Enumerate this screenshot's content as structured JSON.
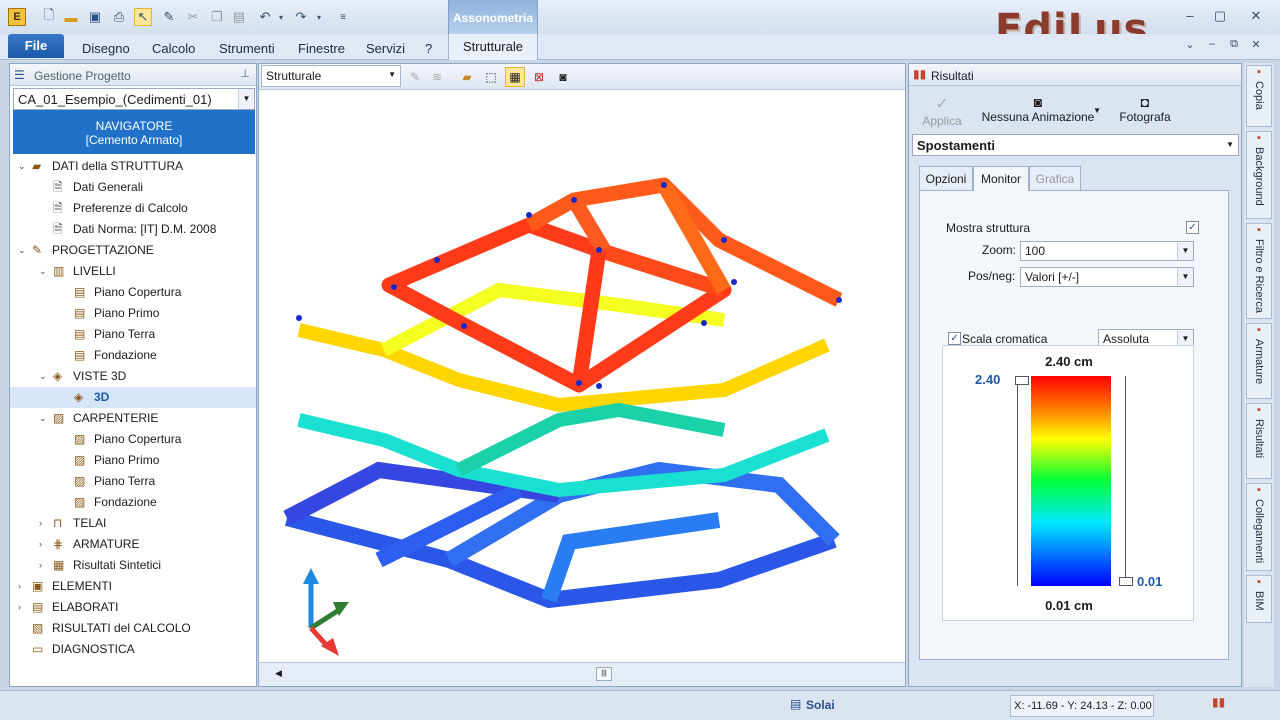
{
  "titlebar": {
    "context_tab": "Assonometria",
    "brand": "EdiLus",
    "win_controls": [
      "–",
      "▢",
      "✕"
    ],
    "doc_controls": [
      "⌄",
      "–",
      "⧉",
      "✕"
    ]
  },
  "menu": {
    "file": "File",
    "items": [
      "Disegno",
      "Calcolo",
      "Strumenti",
      "Finestre",
      "Servizi",
      "?"
    ],
    "context_sub": "Strutturale"
  },
  "left_panel": {
    "title": "Gestione Progetto",
    "project": "CA_01_Esempio_(Cedimenti_01)",
    "navigator_line1": "NAVIGATORE",
    "navigator_line2": "[Cemento Armato]",
    "tree": [
      {
        "label": "DATI della STRUTTURA",
        "level": 0,
        "expander": "⌄",
        "icon": "folder-icon"
      },
      {
        "label": "Dati Generali",
        "level": 1,
        "expander": "",
        "icon": "document-icon"
      },
      {
        "label": "Preferenze di Calcolo",
        "level": 1,
        "expander": "",
        "icon": "document-icon"
      },
      {
        "label": "Dati Norma: [IT] D.M. 2008",
        "level": 1,
        "expander": "",
        "icon": "document-icon"
      },
      {
        "label": "PROGETTAZIONE",
        "level": 0,
        "expander": "⌄",
        "icon": "design-icon"
      },
      {
        "label": "LIVELLI",
        "level": 1,
        "expander": "⌄",
        "icon": "levels-icon"
      },
      {
        "label": "Piano Copertura",
        "level": 2,
        "expander": "",
        "icon": "floor-icon"
      },
      {
        "label": "Piano Primo",
        "level": 2,
        "expander": "",
        "icon": "floor-icon"
      },
      {
        "label": "Piano Terra",
        "level": 2,
        "expander": "",
        "icon": "floor-icon"
      },
      {
        "label": "Fondazione",
        "level": 2,
        "expander": "",
        "icon": "floor-icon"
      },
      {
        "label": "VISTE 3D",
        "level": 1,
        "expander": "⌄",
        "icon": "view3d-icon"
      },
      {
        "label": "3D",
        "level": 2,
        "expander": "",
        "icon": "view3d-icon",
        "selected": true
      },
      {
        "label": "CARPENTERIE",
        "level": 1,
        "expander": "⌄",
        "icon": "formwork-icon"
      },
      {
        "label": "Piano Copertura",
        "level": 2,
        "expander": "",
        "icon": "formwork-icon"
      },
      {
        "label": "Piano Primo",
        "level": 2,
        "expander": "",
        "icon": "formwork-icon"
      },
      {
        "label": "Piano Terra",
        "level": 2,
        "expander": "",
        "icon": "formwork-icon"
      },
      {
        "label": "Fondazione",
        "level": 2,
        "expander": "",
        "icon": "formwork-icon"
      },
      {
        "label": "TELAI",
        "level": 1,
        "expander": "›",
        "icon": "frame-icon"
      },
      {
        "label": "ARMATURE",
        "level": 1,
        "expander": "›",
        "icon": "rebar-icon"
      },
      {
        "label": "Risultati Sintetici",
        "level": 1,
        "expander": "›",
        "icon": "results-icon"
      },
      {
        "label": "ELEMENTI",
        "level": 0,
        "expander": "›",
        "icon": "elements-icon"
      },
      {
        "label": "ELABORATI",
        "level": 0,
        "expander": "›",
        "icon": "printouts-icon"
      },
      {
        "label": "RISULTATI del CALCOLO",
        "level": 0,
        "expander": "",
        "icon": "calc-results-icon"
      },
      {
        "label": "DIAGNOSTICA",
        "level": 0,
        "expander": "",
        "icon": "diagnostics-icon"
      }
    ]
  },
  "viewport": {
    "view_select": "Strutturale"
  },
  "right_panel": {
    "title": "Risultati",
    "applica": "Applica",
    "animazione": "Nessuna Animazione",
    "fotografa": "Fotografa",
    "result_type": "Spostamenti",
    "tabs": [
      "Opzioni",
      "Monitor",
      "Grafica"
    ],
    "active_tab": "Monitor",
    "mostra_struttura": "Mostra struttura",
    "zoom_label": "Zoom:",
    "zoom_value": "100",
    "posneg_label": "Pos/neg:",
    "posneg_value": "Valori  [+/-]",
    "scala_label": "Scala cromatica",
    "scala_value": "Assoluta",
    "scale_top": "2.40 cm",
    "scale_bottom": "0.01 cm",
    "max_marker": "2.40",
    "min_marker": "0.01"
  },
  "sidebar_tabs": [
    "Copia",
    "Background",
    "Filtro e Ricerca",
    "Armature",
    "Risultati",
    "Collegamenti",
    "BIM"
  ],
  "status": {
    "solai": "Solai",
    "coords": "X: -11.69 - Y: 24.13 - Z: 0.00"
  },
  "colors": {
    "accent": "#1f72c8",
    "brand": "#8a3b2e",
    "scale_high": "#ff0000",
    "scale_low": "#0000ff"
  }
}
